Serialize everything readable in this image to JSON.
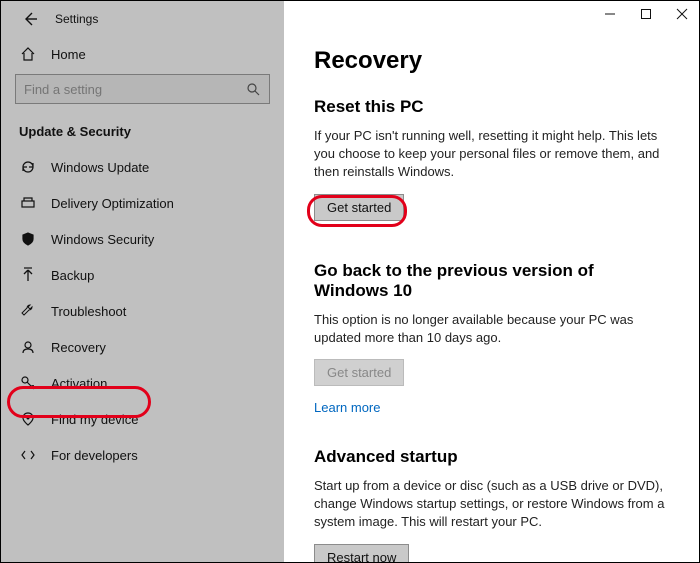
{
  "window": {
    "title": "Settings"
  },
  "home_label": "Home",
  "search": {
    "placeholder": "Find a setting"
  },
  "section_header": "Update & Security",
  "sidebar": {
    "items": [
      {
        "label": "Windows Update"
      },
      {
        "label": "Delivery Optimization"
      },
      {
        "label": "Windows Security"
      },
      {
        "label": "Backup"
      },
      {
        "label": "Troubleshoot"
      },
      {
        "label": "Recovery"
      },
      {
        "label": "Activation"
      },
      {
        "label": "Find my device"
      },
      {
        "label": "For developers"
      }
    ]
  },
  "page": {
    "title": "Recovery",
    "reset": {
      "heading": "Reset this PC",
      "body": "If your PC isn't running well, resetting it might help. This lets you choose to keep your personal files or remove them, and then reinstalls Windows.",
      "button": "Get started"
    },
    "goback": {
      "heading": "Go back to the previous version of Windows 10",
      "body": "This option is no longer available because your PC was updated more than 10 days ago.",
      "button": "Get started",
      "link": "Learn more"
    },
    "advanced": {
      "heading": "Advanced startup",
      "body": "Start up from a device or disc (such as a USB drive or DVD), change Windows startup settings, or restore Windows from a system image. This will restart your PC.",
      "button": "Restart now"
    }
  }
}
